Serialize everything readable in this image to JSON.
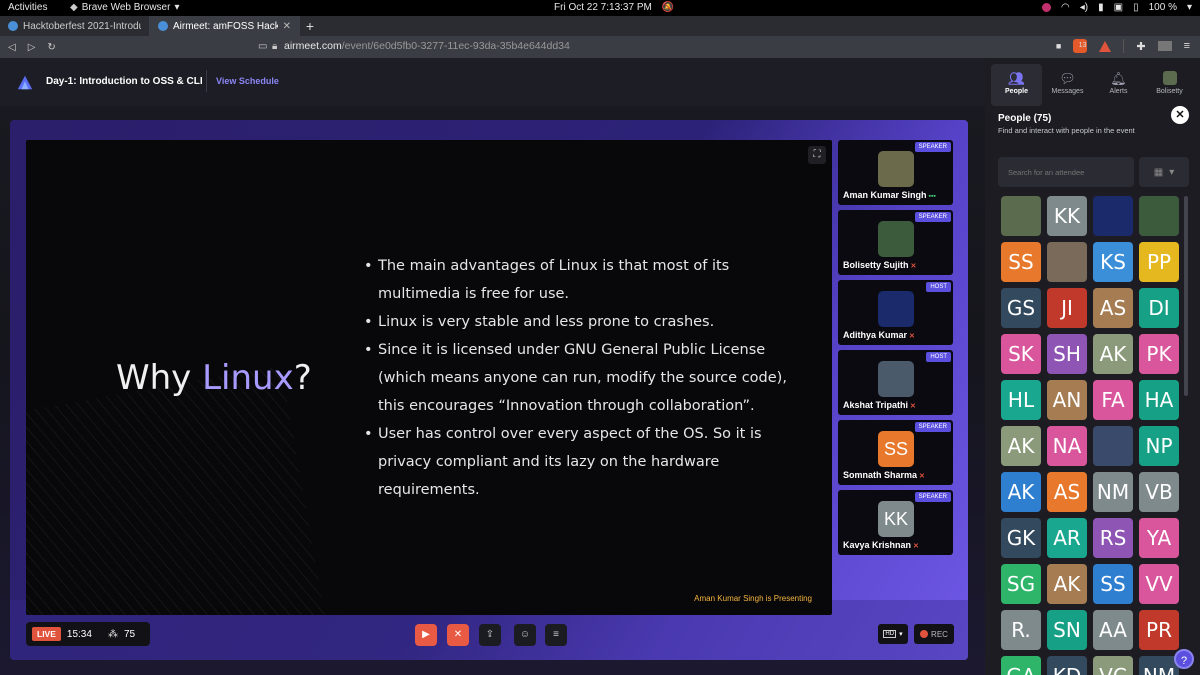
{
  "os_bar": {
    "activities": "Activities",
    "app_name": "Brave Web Browser",
    "clock": "Fri Oct 22  7:13:37 PM",
    "battery": "100 %"
  },
  "browser": {
    "tabs": [
      {
        "label": "Hacktoberfest 2021-Introduc",
        "active": false
      },
      {
        "label": "Airmeet: amFOSS Hackt",
        "active": true
      }
    ],
    "url_host": "airmeet.com",
    "url_path": "/event/6e0d5fb0-3277-11ec-93da-35b4e644dd34",
    "shield_count": "13"
  },
  "header": {
    "event_title": "Day-1: Introduction to OSS & CLI",
    "view_schedule": "View Schedule"
  },
  "slide": {
    "title_prefix": "Why ",
    "title_highlight": "Linux",
    "title_suffix": "?",
    "bullets": [
      "The main advantages of Linux is that most of its multimedia is free for use.",
      "Linux is very stable and less prone to crashes.",
      "Since it is licensed under GNU General Public License (which means anyone can run, modify the source code), this encourages “Innovation through collaboration”.",
      "User has control over every aspect of the OS. So it is privacy compliant and its lazy on the hardware requirements."
    ],
    "presenting": "Aman Kumar Singh is Presenting"
  },
  "speakers": [
    {
      "name": "Aman Kumar Singh",
      "role": "SPEAKER",
      "initials": "",
      "color": "#6b6a4a",
      "status": "live"
    },
    {
      "name": "Bolisetty Sujith",
      "role": "SPEAKER",
      "initials": "",
      "color": "#3c5a3c",
      "status": "muted"
    },
    {
      "name": "Adithya Kumar",
      "role": "HOST",
      "initials": "",
      "color": "#1a2a6a",
      "status": "muted"
    },
    {
      "name": "Akshat Tripathi",
      "role": "HOST",
      "initials": "",
      "color": "#4a5a6a",
      "status": "muted"
    },
    {
      "name": "Somnath Sharma",
      "role": "SPEAKER",
      "initials": "SS",
      "color": "#e8792c",
      "status": "muted"
    },
    {
      "name": "Kavya Krishnan",
      "role": "SPEAKER",
      "initials": "KK",
      "color": "#7f8a8c",
      "status": "muted"
    }
  ],
  "controls": {
    "live_label": "LIVE",
    "timer": "15:34",
    "viewers": "75",
    "quality": "HD",
    "rec_label": "REC"
  },
  "panel": {
    "tabs": [
      "People",
      "Messages",
      "Alerts",
      "Bolisetty"
    ],
    "title": "People (75)",
    "subtitle": "Find and interact with people in the event",
    "search_placeholder": "Search for an attendee",
    "attendees": [
      {
        "i": "",
        "c": "#5a6b4e"
      },
      {
        "i": "KK",
        "c": "#7f8a8c"
      },
      {
        "i": "",
        "c": "#1a2a6a"
      },
      {
        "i": "",
        "c": "#3c5a3c"
      },
      {
        "i": "SS",
        "c": "#e8792c"
      },
      {
        "i": "",
        "c": "#7a6a5a"
      },
      {
        "i": "KS",
        "c": "#3b8fd9"
      },
      {
        "i": "PP",
        "c": "#e6b820"
      },
      {
        "i": "GS",
        "c": "#334a5e"
      },
      {
        "i": "JI",
        "c": "#c0392b"
      },
      {
        "i": "AS",
        "c": "#a67c52"
      },
      {
        "i": "DI",
        "c": "#16a085"
      },
      {
        "i": "SK",
        "c": "#d9569c"
      },
      {
        "i": "SH",
        "c": "#8e55b5"
      },
      {
        "i": "AK",
        "c": "#8a9a7a"
      },
      {
        "i": "PK",
        "c": "#d9569c"
      },
      {
        "i": "HL",
        "c": "#1aa78f"
      },
      {
        "i": "AN",
        "c": "#a67c52"
      },
      {
        "i": "FA",
        "c": "#d9569c"
      },
      {
        "i": "HA",
        "c": "#16a085"
      },
      {
        "i": "AK",
        "c": "#8a9a7a"
      },
      {
        "i": "NA",
        "c": "#d9569c"
      },
      {
        "i": "",
        "c": "#3a4a6a"
      },
      {
        "i": "NP",
        "c": "#16a085"
      },
      {
        "i": "AK",
        "c": "#2f7fd0"
      },
      {
        "i": "AS",
        "c": "#e8792c"
      },
      {
        "i": "NM",
        "c": "#7f8a8c"
      },
      {
        "i": "VB",
        "c": "#7f8a8c"
      },
      {
        "i": "GK",
        "c": "#334a5e"
      },
      {
        "i": "AR",
        "c": "#1aa78f"
      },
      {
        "i": "RS",
        "c": "#8e55b5"
      },
      {
        "i": "YA",
        "c": "#d9569c"
      },
      {
        "i": "SG",
        "c": "#2fb56a"
      },
      {
        "i": "AK",
        "c": "#a67c52"
      },
      {
        "i": "SS",
        "c": "#2f7fd0"
      },
      {
        "i": "VV",
        "c": "#d9569c"
      },
      {
        "i": "R.",
        "c": "#7f8a8c"
      },
      {
        "i": "SN",
        "c": "#16a085"
      },
      {
        "i": "AA",
        "c": "#7f8a8c"
      },
      {
        "i": "PR",
        "c": "#c0392b"
      },
      {
        "i": "GA",
        "c": "#2fb56a"
      },
      {
        "i": "KD",
        "c": "#334a5e"
      },
      {
        "i": "VC",
        "c": "#8a9a7a"
      },
      {
        "i": "NM",
        "c": "#334a5e"
      }
    ]
  },
  "colors": {
    "accent": "#7b74f0",
    "live_red": "#e0533c",
    "presenting_text": "#f5b53f"
  }
}
